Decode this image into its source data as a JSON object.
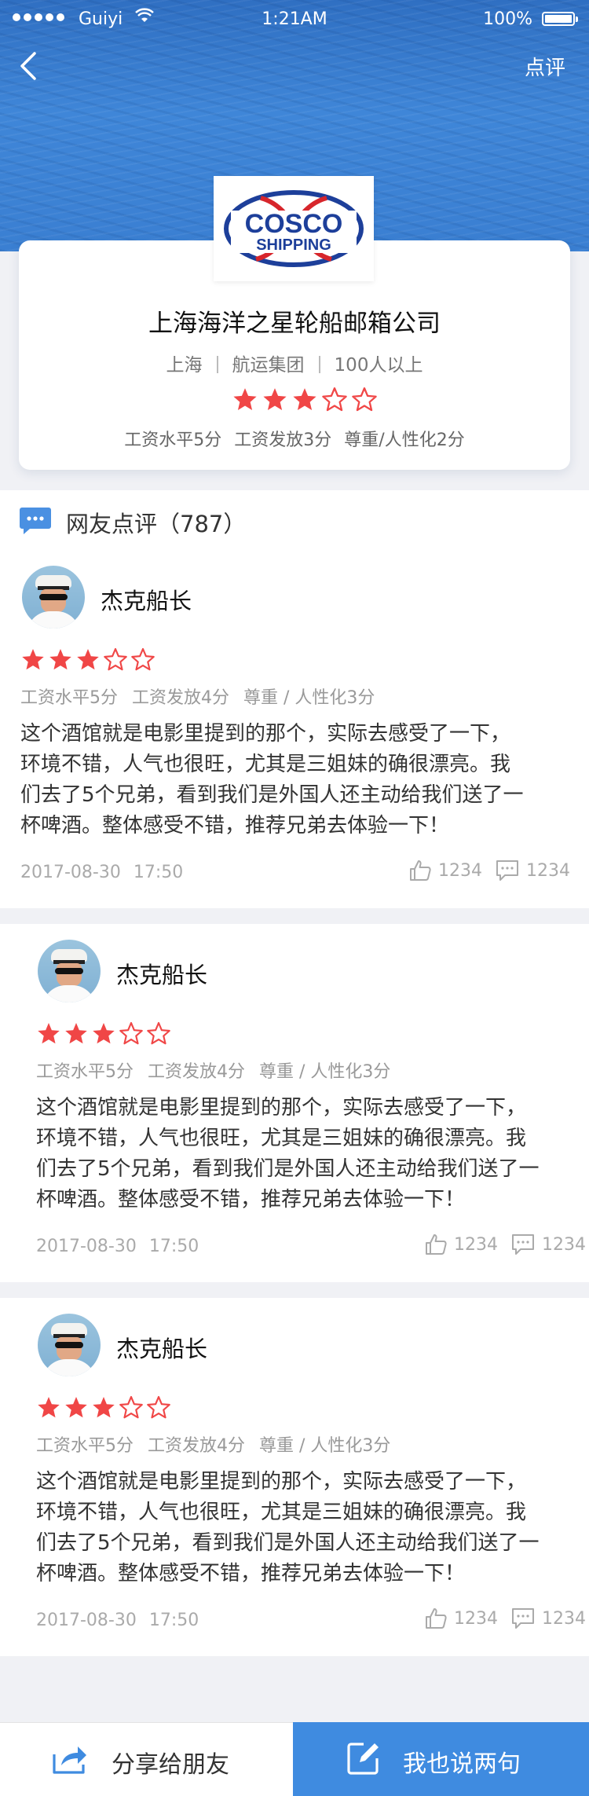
{
  "status_bar": {
    "carrier": "Guiyi",
    "time": "1:21AM",
    "battery": "100%"
  },
  "nav": {
    "review_action": "点评"
  },
  "company": {
    "name": "上海海洋之星轮船邮箱公司",
    "city": "上海",
    "industry": "航运集团",
    "size": "100人以上",
    "rating": 3,
    "scores": [
      "工资水平5分",
      "工资发放3分",
      "尊重/人性化2分"
    ],
    "logo": {
      "line1": "COSCO",
      "line2": "SHIPPING",
      "colors": {
        "blue": "#1d3f9a",
        "red": "#d7262c"
      }
    }
  },
  "reviews_section": {
    "title": "网友点评（787）"
  },
  "reviews": [
    {
      "name": "杰克船长",
      "rating": 3,
      "scores": [
        "工资水平5分",
        "工资发放4分",
        "尊重 / 人性化3分"
      ],
      "text_lines": [
        "这个酒馆就是电影里提到的那个，实际去感受了一下，",
        "环境不错，人气也很旺，尤其是三姐妹的确很漂亮。我",
        "们去了5个兄弟，看到我们是外国人还主动给我们送了一",
        "杯啤酒。整体感受不错，推荐兄弟去体验一下！"
      ],
      "date": "2017-08-30",
      "time": "17:50",
      "likes": "1234",
      "comments": "1234"
    },
    {
      "name": "杰克船长",
      "rating": 3,
      "scores": [
        "工资水平5分",
        "工资发放4分",
        "尊重 / 人性化3分"
      ],
      "text_lines": [
        "这个酒馆就是电影里提到的那个，实际去感受了一下，",
        "环境不错，人气也很旺，尤其是三姐妹的确很漂亮。我",
        "们去了5个兄弟，看到我们是外国人还主动给我们送了一",
        "杯啤酒。整体感受不错，推荐兄弟去体验一下！"
      ],
      "date": "2017-08-30",
      "time": "17:50",
      "likes": "1234",
      "comments": "1234"
    },
    {
      "name": "杰克船长",
      "rating": 3,
      "scores": [
        "工资水平5分",
        "工资发放4分",
        "尊重 / 人性化3分"
      ],
      "text_lines": [
        "这个酒馆就是电影里提到的那个，实际去感受了一下，",
        "环境不错，人气也很旺，尤其是三姐妹的确很漂亮。我",
        "们去了5个兄弟，看到我们是外国人还主动给我们送了一",
        "杯啤酒。整体感受不错，推荐兄弟去体验一下！"
      ],
      "date": "2017-08-30",
      "time": "17:50",
      "likes": "1234",
      "comments": "1234"
    }
  ],
  "bottom_bar": {
    "share_label": "分享给朋友",
    "write_label": "我也说两句"
  },
  "colors": {
    "accent": "#3f8be0",
    "star": "#f04646",
    "header_sea": "#3a7fd2"
  },
  "icons": [
    "back-arrow-icon",
    "chat-bubble-icon",
    "star-icon",
    "thumbs-up-icon",
    "comment-icon",
    "share-icon",
    "edit-icon"
  ]
}
